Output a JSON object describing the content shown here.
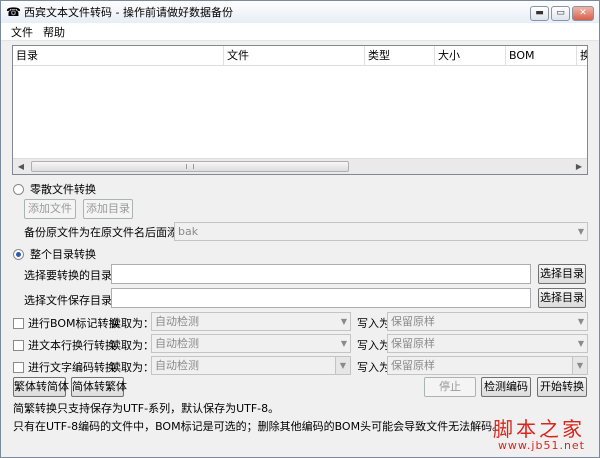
{
  "window": {
    "title": "西宾文本文件转码 - 操作前请做好数据备份",
    "min": "▬",
    "max": "▭",
    "close": "✕"
  },
  "menu": [
    "文件",
    "帮助"
  ],
  "list": {
    "columns": [
      "目录",
      "文件",
      "类型",
      "大小",
      "BOM",
      "换"
    ]
  },
  "scattered": {
    "radio_label": "零散文件转换",
    "add_file": "添加文件",
    "add_dir": "添加目录",
    "backup_label": "备份原文件为在原文件名后面添加：",
    "backup_value": "bak"
  },
  "dir_mode": {
    "radio_label": "整个目录转换",
    "src_label": "选择要转换的目录：",
    "src_button": "选择目录",
    "dst_label": "选择文件保存目录：",
    "dst_button": "选择目录"
  },
  "options": [
    {
      "label": "进行BOM标记转换",
      "read_label": "读取为：",
      "read_value": "自动检测",
      "write_label": "写入为",
      "write_value": "保留原样"
    },
    {
      "label": "进文本行换行转换",
      "read_label": "读取为：",
      "read_value": "自动检测",
      "write_label": "写入为",
      "write_value": "保留原样"
    },
    {
      "label": "进行文字编码转换",
      "read_label": "读取为：",
      "read_value": "自动检测",
      "write_label": "写入为",
      "write_value": "保留原样"
    }
  ],
  "actions": {
    "trad_to_simp": "繁体转简体",
    "simp_to_trad": "简体转繁体",
    "stop": "停止",
    "detect": "检测编码",
    "start": "开始转换"
  },
  "notes": [
    "简繁转换只支持保存为UTF-系列，默认保存为UTF-8。",
    "只有在UTF-8编码的文件中，BOM标记是可选的；删除其他编码的BOM头可能会导致文件无法解码。"
  ],
  "watermark": {
    "title": "脚本之家",
    "url": "www.jb51.net"
  }
}
